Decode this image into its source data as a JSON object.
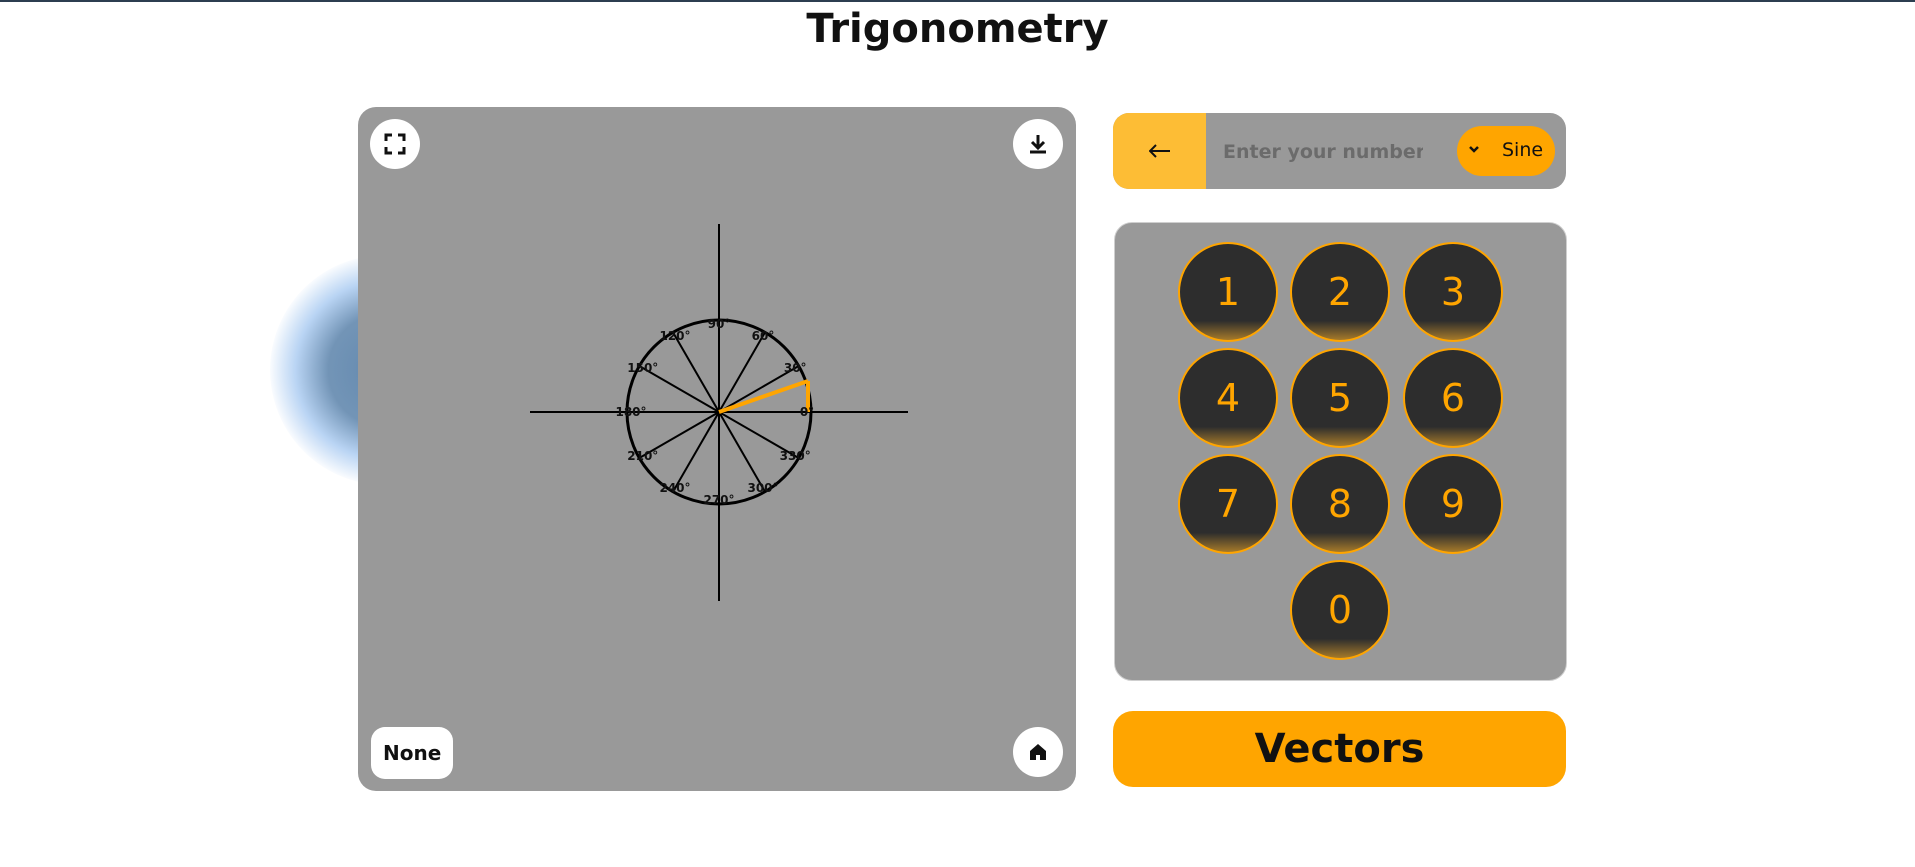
{
  "page_title": "Trigonometry",
  "canvas": {
    "mode_button_label": "None",
    "angle_labels": [
      "90°",
      "60°",
      "30°",
      "0°",
      "330°",
      "300°",
      "270°",
      "240°",
      "210°",
      "180°",
      "150°",
      "120°"
    ],
    "highlight_color": "#ffa500",
    "panel_color": "#999999"
  },
  "input_bar": {
    "back_icon": "arrow-left-icon",
    "placeholder": "Enter your number...",
    "value": "",
    "function_selected": "Sine"
  },
  "keypad": {
    "keys": [
      "1",
      "2",
      "3",
      "4",
      "5",
      "6",
      "7",
      "8",
      "9",
      "0"
    ]
  },
  "vectors_button_label": "Vectors",
  "colors": {
    "accent": "#ffa500",
    "accent_light": "#fdbd35",
    "key_bg": "#2d2d2d"
  }
}
